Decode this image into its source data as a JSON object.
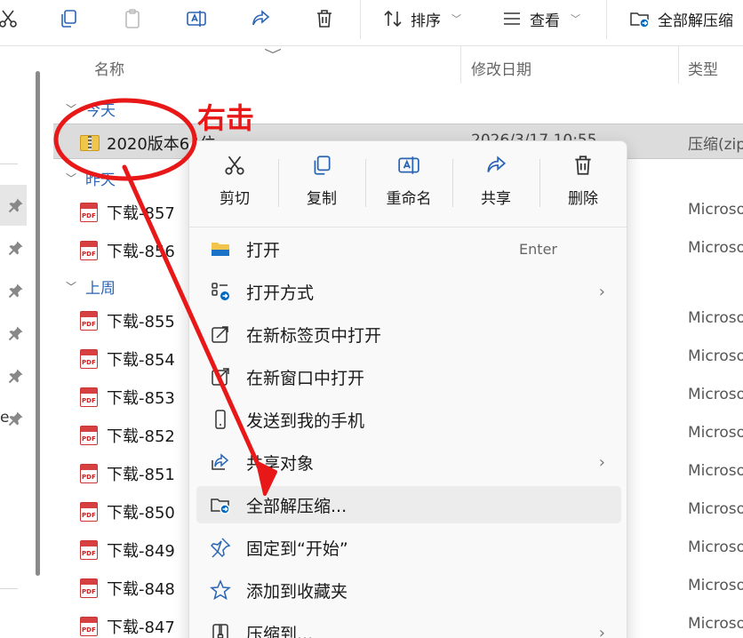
{
  "toolbar": {
    "sort_label": "排序",
    "view_label": "查看",
    "extract_label": "全部解压缩"
  },
  "columns": {
    "name": "名称",
    "date": "修改日期",
    "type": "类型"
  },
  "groups": {
    "today": "今天",
    "yesterday": "昨天",
    "last_week": "上周"
  },
  "rows": {
    "zip": {
      "name": "2020版本64位",
      "date": "2026/3/17 10:55",
      "type": "压缩(zip"
    },
    "r857": {
      "name": "下载-857",
      "type": "Microso"
    },
    "r856": {
      "name": "下载-856",
      "type": "Microso"
    },
    "r855": {
      "name": "下载-855",
      "type": "Microso"
    },
    "r854": {
      "name": "下载-854",
      "type": "Microso"
    },
    "r853": {
      "name": "下载-853",
      "type": "Microso"
    },
    "r852": {
      "name": "下载-852",
      "type": "Microso"
    },
    "r851": {
      "name": "下载-851",
      "type": "Microso"
    },
    "r850": {
      "name": "下载-850",
      "type": "Microso"
    },
    "r849": {
      "name": "下载-849",
      "type": "Microso"
    },
    "r848": {
      "name": "下载-848",
      "type": "Microso"
    },
    "r847": {
      "name": "下载-847",
      "type": "Microso"
    }
  },
  "pdf_badge": "PDF",
  "nav_stray": "e",
  "context_menu": {
    "actions": {
      "cut": "剪切",
      "copy": "复制",
      "rename": "重命名",
      "share": "共享",
      "delete": "删除"
    },
    "items": {
      "open": {
        "label": "打开",
        "accel": "Enter"
      },
      "open_with": {
        "label": "打开方式"
      },
      "open_new_tab": {
        "label": "在新标签页中打开"
      },
      "open_new_window": {
        "label": "在新窗口中打开"
      },
      "send_phone": {
        "label": "发送到我的手机"
      },
      "share_object": {
        "label": "共享对象"
      },
      "extract_all": {
        "label": "全部解压缩..."
      },
      "pin_start": {
        "label": "固定到“开始”"
      },
      "add_fav": {
        "label": "添加到收藏夹"
      },
      "compress_to": {
        "label": "压缩到..."
      }
    },
    "submenu_chevron": "›"
  },
  "annotation": {
    "label": "右击",
    "color": "#e81818"
  },
  "colors": {
    "accent": "#0067c0",
    "group_text": "#2a64b4",
    "annotation": "#e81818"
  }
}
